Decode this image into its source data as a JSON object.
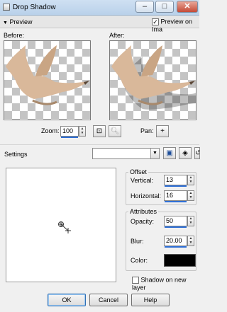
{
  "window": {
    "title": "Drop Shadow",
    "minimize": "–",
    "maximize": "□",
    "close": "✕"
  },
  "preview_section": {
    "toggle_label": "Preview",
    "preview_on_image_label": "Preview on Ima",
    "preview_on_image_checked": true
  },
  "panes": {
    "before_label": "Before:",
    "after_label": "After:"
  },
  "zoom": {
    "label": "Zoom:",
    "value": "100",
    "pan_label": "Pan:"
  },
  "settings": {
    "label": "Settings",
    "preset_value": ""
  },
  "offset": {
    "group_title": "Offset",
    "vertical_label": "Vertical:",
    "vertical_value": "13",
    "horizontal_label": "Horizontal:",
    "horizontal_value": "16"
  },
  "attributes": {
    "group_title": "Attributes",
    "opacity_label": "Opacity:",
    "opacity_value": "50",
    "blur_label": "Blur:",
    "blur_value": "20.00",
    "color_label": "Color:",
    "color_value": "#000000"
  },
  "shadow_new_layer": {
    "label": "Shadow on new layer",
    "checked": false
  },
  "buttons": {
    "ok": "OK",
    "cancel": "Cancel",
    "help": "Help"
  },
  "colors": {
    "accent": "#2e6fd6",
    "bird": "#d9b89a"
  }
}
